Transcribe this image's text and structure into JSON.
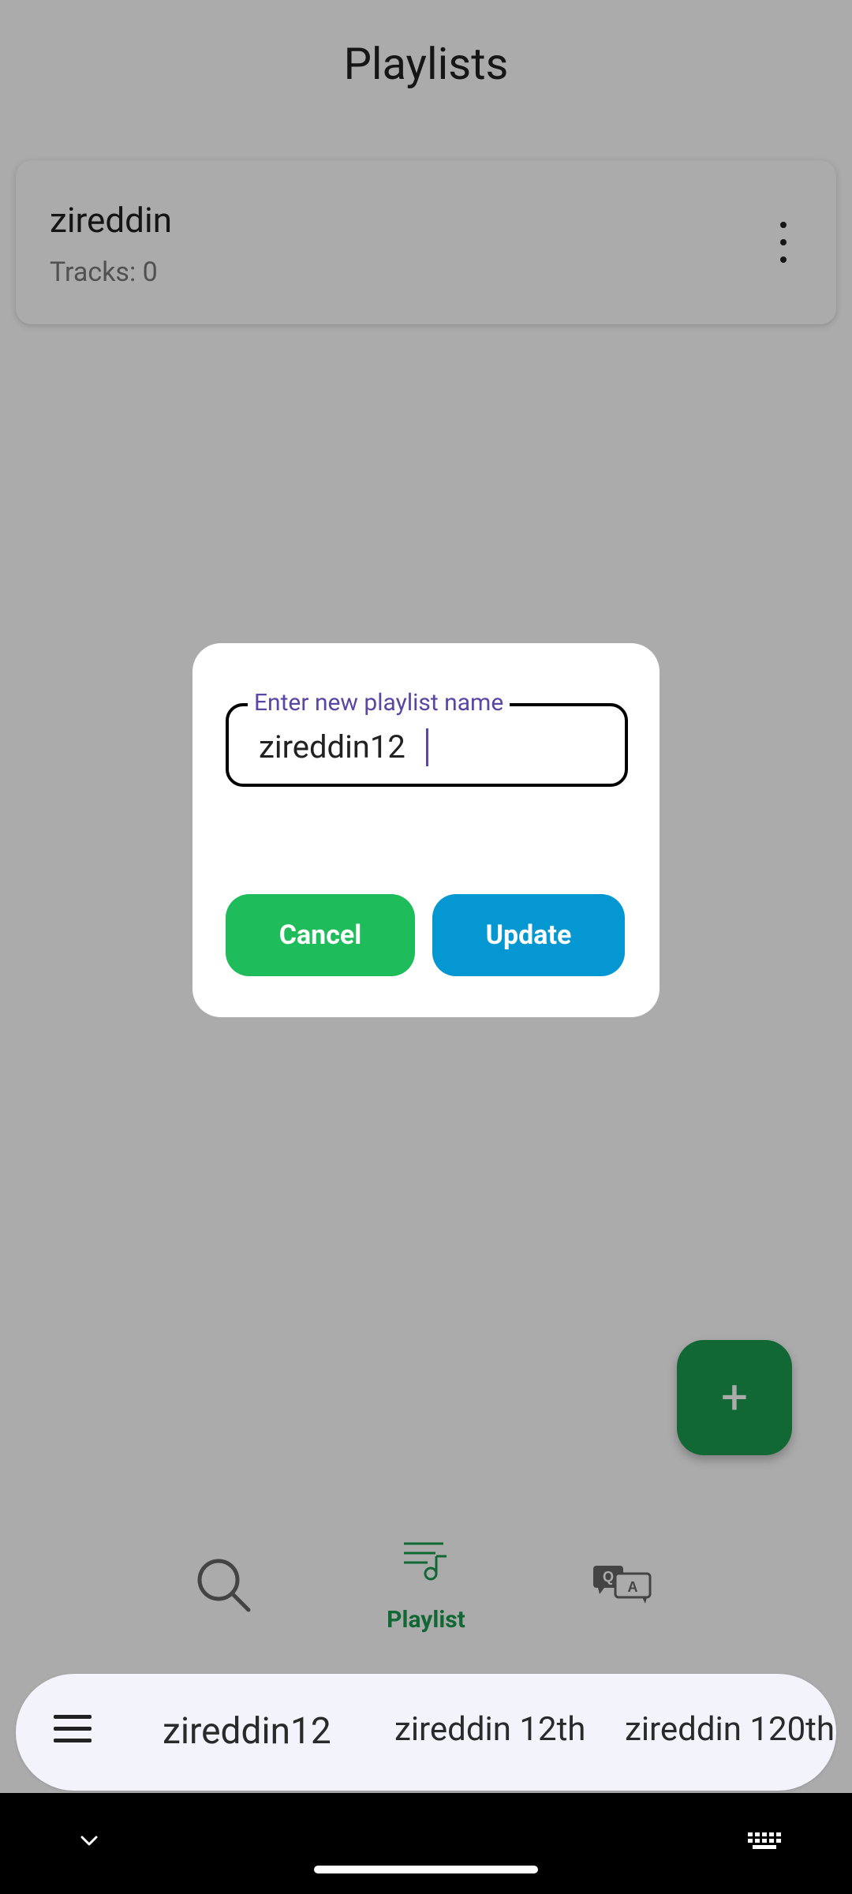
{
  "app": {
    "title": "Playlists"
  },
  "playlist": {
    "name": "zireddin",
    "tracks_label": "Tracks: 0"
  },
  "fab": {
    "label": "+"
  },
  "nav": {
    "playlist_label": "Playlist"
  },
  "dialog": {
    "field_label": "Enter new playlist name",
    "input_value": "zireddin12",
    "cancel_label": "Cancel",
    "update_label": "Update"
  },
  "keyboard": {
    "suggestions": [
      "zireddin12",
      "zireddin 12th",
      "zireddin 120th"
    ]
  },
  "colors": {
    "accent_green": "#1a9c4e",
    "cancel_green": "#1ebc5b",
    "update_blue": "#0497d1",
    "label_purple": "#5b46a3"
  }
}
